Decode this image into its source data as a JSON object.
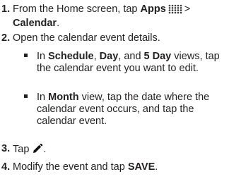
{
  "step1": {
    "num": "1.",
    "t1": "From the Home screen, tap ",
    "apps": "Apps",
    "gt": ">",
    "calendar": "Calendar",
    "end": ".",
    "icon": "apps-grid-icon"
  },
  "step2": {
    "num": "2.",
    "text": "Open the calendar event details.",
    "bullets": [
      {
        "t1": "In ",
        "schedule": "Schedule",
        "c1": ", ",
        "day": "Day",
        "c2": ", and ",
        "fiveday": "5 Day",
        "t2": " views, tap the calendar event you want to edit."
      },
      {
        "t1": "In ",
        "month": "Month",
        "t2": " view, tap the date where the calendar event occurs, and tap the calendar event."
      }
    ]
  },
  "step3": {
    "num": "3.",
    "t1": "Tap",
    "end": ".",
    "icon": "pencil-edit-icon"
  },
  "step4": {
    "num": "4.",
    "t1": "Modify the event and tap ",
    "save": "SAVE",
    "end": "."
  }
}
